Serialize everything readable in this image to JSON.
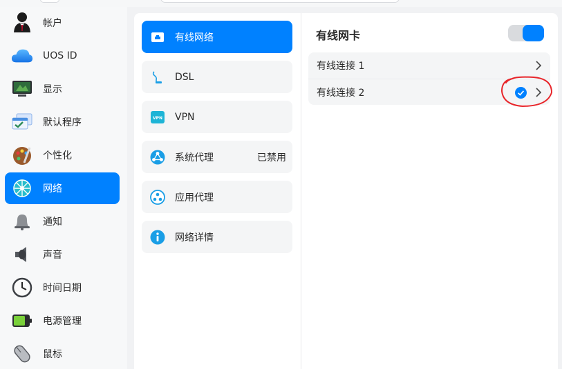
{
  "sidebar": {
    "items": [
      {
        "label": "帐户",
        "icon": "user-icon"
      },
      {
        "label": "UOS ID",
        "icon": "cloud-icon"
      },
      {
        "label": "显示",
        "icon": "monitor-icon"
      },
      {
        "label": "默认程序",
        "icon": "default-apps-icon"
      },
      {
        "label": "个性化",
        "icon": "palette-icon"
      },
      {
        "label": "网络",
        "icon": "network-globe-icon",
        "active": true
      },
      {
        "label": "通知",
        "icon": "bell-icon"
      },
      {
        "label": "声音",
        "icon": "speaker-icon"
      },
      {
        "label": "时间日期",
        "icon": "clock-icon"
      },
      {
        "label": "电源管理",
        "icon": "battery-icon"
      },
      {
        "label": "鼠标",
        "icon": "mouse-icon"
      }
    ]
  },
  "network_menu": {
    "items": [
      {
        "label": "有线网络",
        "icon": "wired-network-icon",
        "active": true
      },
      {
        "label": "DSL",
        "icon": "dsl-icon"
      },
      {
        "label": "VPN",
        "icon": "vpn-icon",
        "icon_text": "VPN"
      },
      {
        "label": "系统代理",
        "icon": "system-proxy-icon",
        "status": "已禁用"
      },
      {
        "label": "应用代理",
        "icon": "app-proxy-icon"
      },
      {
        "label": "网络详情",
        "icon": "info-icon"
      }
    ]
  },
  "wired_panel": {
    "title": "有线网卡",
    "toggle_on": true,
    "connections": [
      {
        "label": "有线连接 1",
        "connected": false
      },
      {
        "label": "有线连接 2",
        "connected": true
      }
    ]
  },
  "colors": {
    "accent": "#0081ff",
    "annotation": "#e8262b"
  }
}
